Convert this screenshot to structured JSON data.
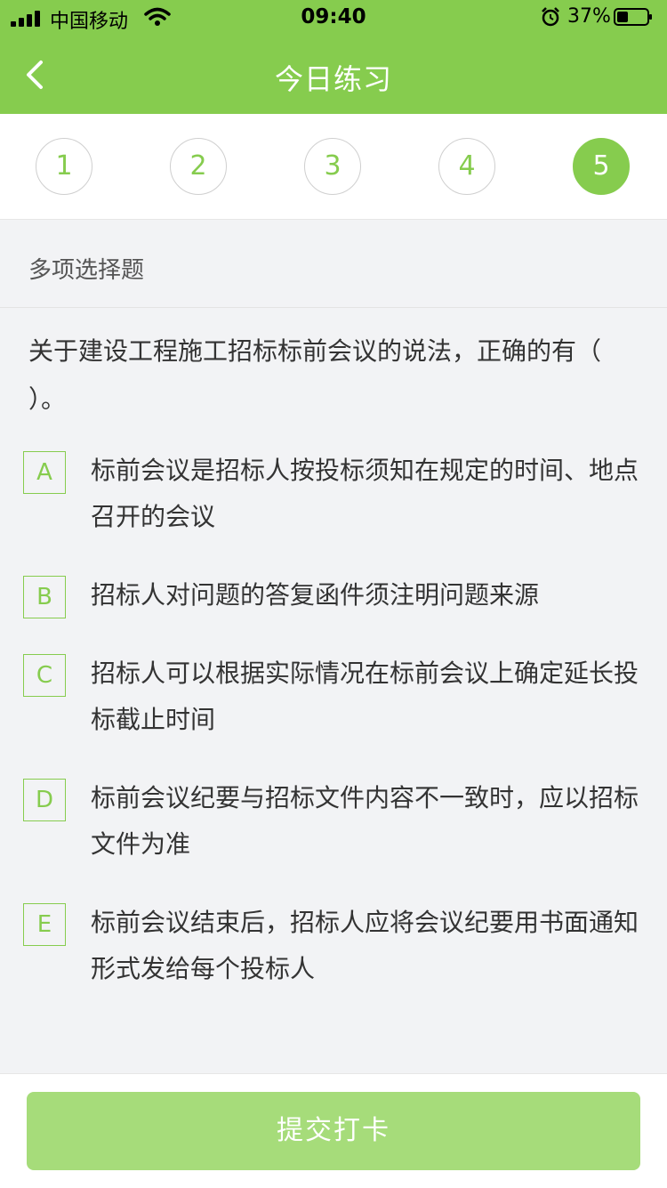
{
  "status_bar": {
    "carrier": "中国移动",
    "time": "09:40",
    "battery_percent": "37%"
  },
  "nav": {
    "title": "今日练习",
    "back_icon": "chevron-left-icon"
  },
  "question_numbers": [
    {
      "label": "1",
      "active": false
    },
    {
      "label": "2",
      "active": false
    },
    {
      "label": "3",
      "active": false
    },
    {
      "label": "4",
      "active": false
    },
    {
      "label": "5",
      "active": true
    }
  ],
  "question_type": "多项选择题",
  "question_text": "关于建设工程施工招标标前会议的说法，正确的有（ ）。",
  "options": [
    {
      "letter": "A",
      "text": "标前会议是招标人按投标须知在规定的时间、地点召开的会议"
    },
    {
      "letter": "B",
      "text": "招标人对问题的答复函件须注明问题来源"
    },
    {
      "letter": "C",
      "text": "招标人可以根据实际情况在标前会议上确定延长投标截止时间"
    },
    {
      "letter": "D",
      "text": "标前会议纪要与招标文件内容不一致时，应以招标文件为准"
    },
    {
      "letter": "E",
      "text": "标前会议结束后，招标人应将会议纪要用书面通知形式发给每个投标人"
    }
  ],
  "submit_label": "提交打卡",
  "colors": {
    "primary": "#86cc4e",
    "submit_disabled": "#a6dc7a",
    "background": "#f2f3f5"
  }
}
